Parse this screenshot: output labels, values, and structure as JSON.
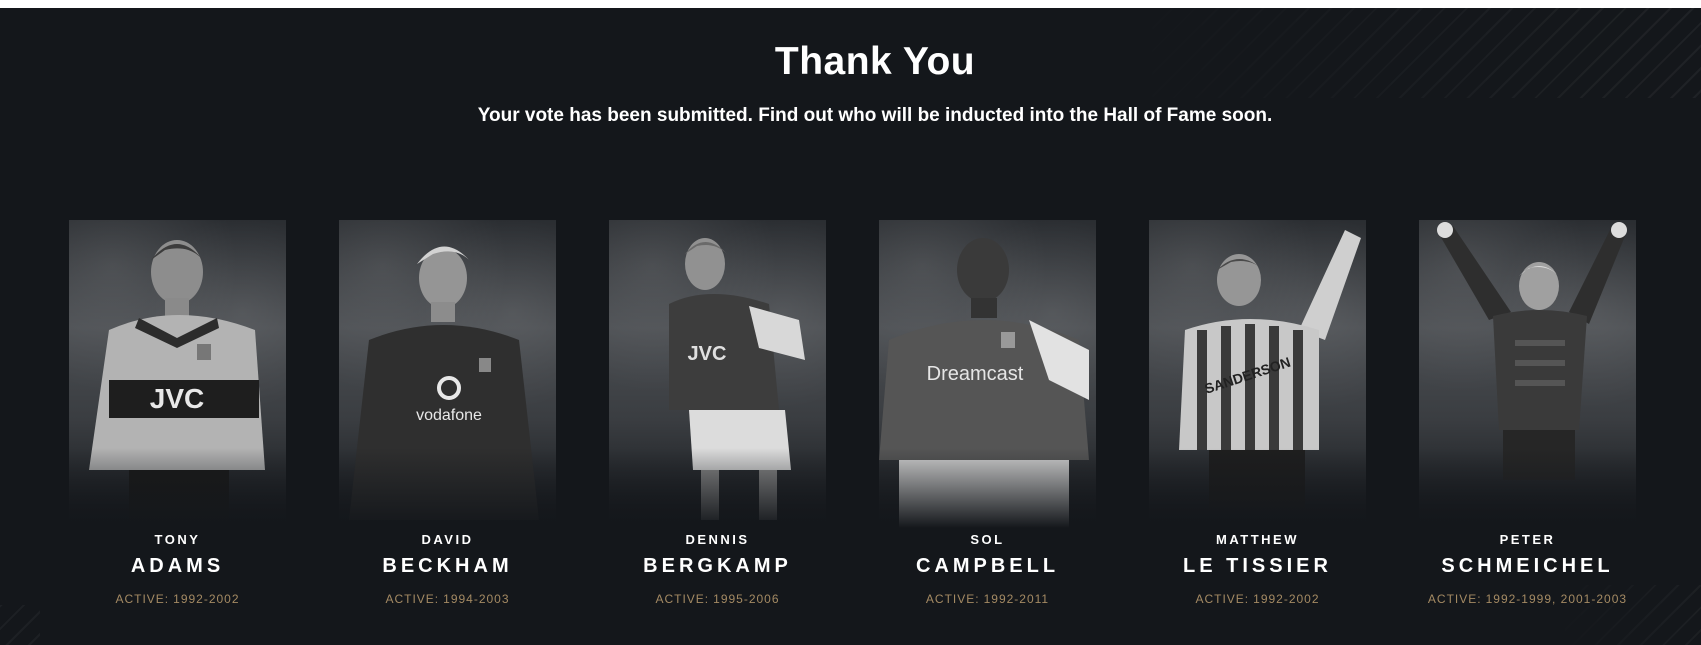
{
  "header": {
    "title": "Thank You",
    "subtitle": "Your vote has been submitted. Find out who will be inducted into the Hall of Fame soon."
  },
  "colors": {
    "background": "#14171b",
    "accent_gold": "#a48a63",
    "text": "#ffffff"
  },
  "active_label": "ACTIVE:",
  "players": [
    {
      "first": "TONY",
      "last": "ADAMS",
      "active": "1992-2002",
      "shirt_text": "JVC"
    },
    {
      "first": "DAVID",
      "last": "BECKHAM",
      "active": "1994-2003",
      "shirt_text": "vodafone"
    },
    {
      "first": "DENNIS",
      "last": "BERGKAMP",
      "active": "1995-2006",
      "shirt_text": "JVC"
    },
    {
      "first": "SOL",
      "last": "CAMPBELL",
      "active": "1992-2011",
      "shirt_text": "Dreamcast"
    },
    {
      "first": "MATTHEW",
      "last": "LE TISSIER",
      "active": "1992-2002",
      "shirt_text": "SANDERSON"
    },
    {
      "first": "PETER",
      "last": "SCHMEICHEL",
      "active": "1992-1999, 2001-2003",
      "shirt_text": ""
    }
  ]
}
